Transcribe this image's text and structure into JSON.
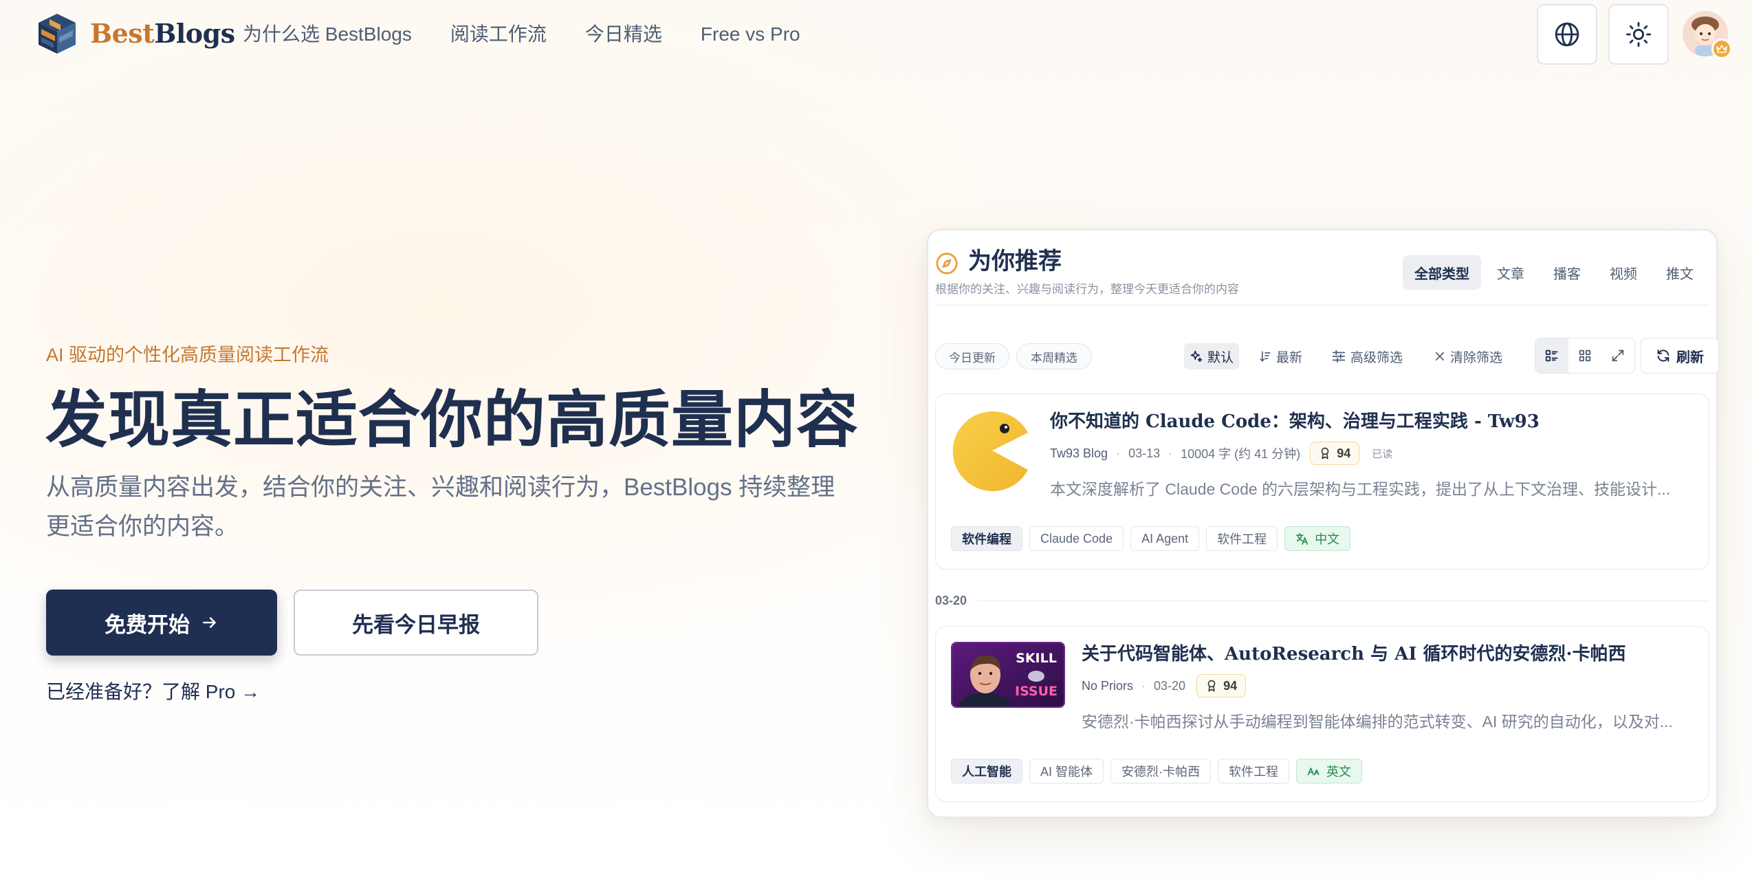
{
  "brand": {
    "part1": "Best",
    "part2": "Blogs"
  },
  "nav": [
    {
      "label": "为什么选 BestBlogs"
    },
    {
      "label": "阅读工作流"
    },
    {
      "label": "今日精选"
    },
    {
      "label": "Free vs Pro"
    }
  ],
  "header_icons": {
    "language": "globe-icon",
    "theme": "sun-icon",
    "avatar_badge": "crown-icon"
  },
  "hero": {
    "eyebrow": "AI 驱动的个性化高质量阅读工作流",
    "title": "发现真正适合你的高质量内容",
    "subtitle": "从高质量内容出发，结合你的关注、兴趣和阅读行为，BestBlogs 持续整理更适合你的内容。",
    "primary_button": "免费开始",
    "secondary_button": "先看今日早报",
    "pro_link": "已经准备好？了解 Pro →"
  },
  "panel": {
    "title": "为你推荐",
    "description": "根据你的关注、兴趣与阅读行为，整理今天更适合你的内容",
    "type_tabs": [
      {
        "label": "全部类型",
        "active": true
      },
      {
        "label": "文章"
      },
      {
        "label": "播客"
      },
      {
        "label": "视频"
      },
      {
        "label": "推文"
      }
    ],
    "chips": [
      "今日更新",
      "本周精选"
    ],
    "sort": {
      "default": "默认",
      "latest": "最新"
    },
    "advanced_filter": "高级筛选",
    "clear_filter": "清除筛选",
    "refresh": "刷新",
    "date_separator": "03-20",
    "articles": [
      {
        "title": "你不知道的 Claude Code：架构、治理与工程实践 - Tw93",
        "source": "Tw93 Blog",
        "date": "03-13",
        "length": "10004 字 (约 41 分钟)",
        "score": "94",
        "read_status": "已读",
        "summary": "本文深度解析了 Claude Code 的六层架构与工程实践，提出了从上下文治理、技能设计...",
        "tags": [
          "软件编程",
          "Claude Code",
          "AI Agent",
          "软件工程"
        ],
        "language": "中文"
      },
      {
        "title": "关于代码智能体、AutoResearch 与 AI 循环时代的安德烈·卡帕西",
        "source": "No Priors",
        "date": "03-20",
        "score": "94",
        "thumb_text": [
          "SKILL",
          "ISSUE"
        ],
        "summary": "安德烈·卡帕西探讨从手动编程到智能体编排的范式转变、AI 研究的自动化，以及对...",
        "tags": [
          "人工智能",
          "AI 智能体",
          "安德烈·卡帕西",
          "软件工程"
        ],
        "language": "英文"
      }
    ]
  },
  "colors": {
    "navy": "#1f2f52",
    "accent": "#c9772d",
    "score_border": "#f1d79e",
    "lang_green": "#2c8a4d"
  }
}
